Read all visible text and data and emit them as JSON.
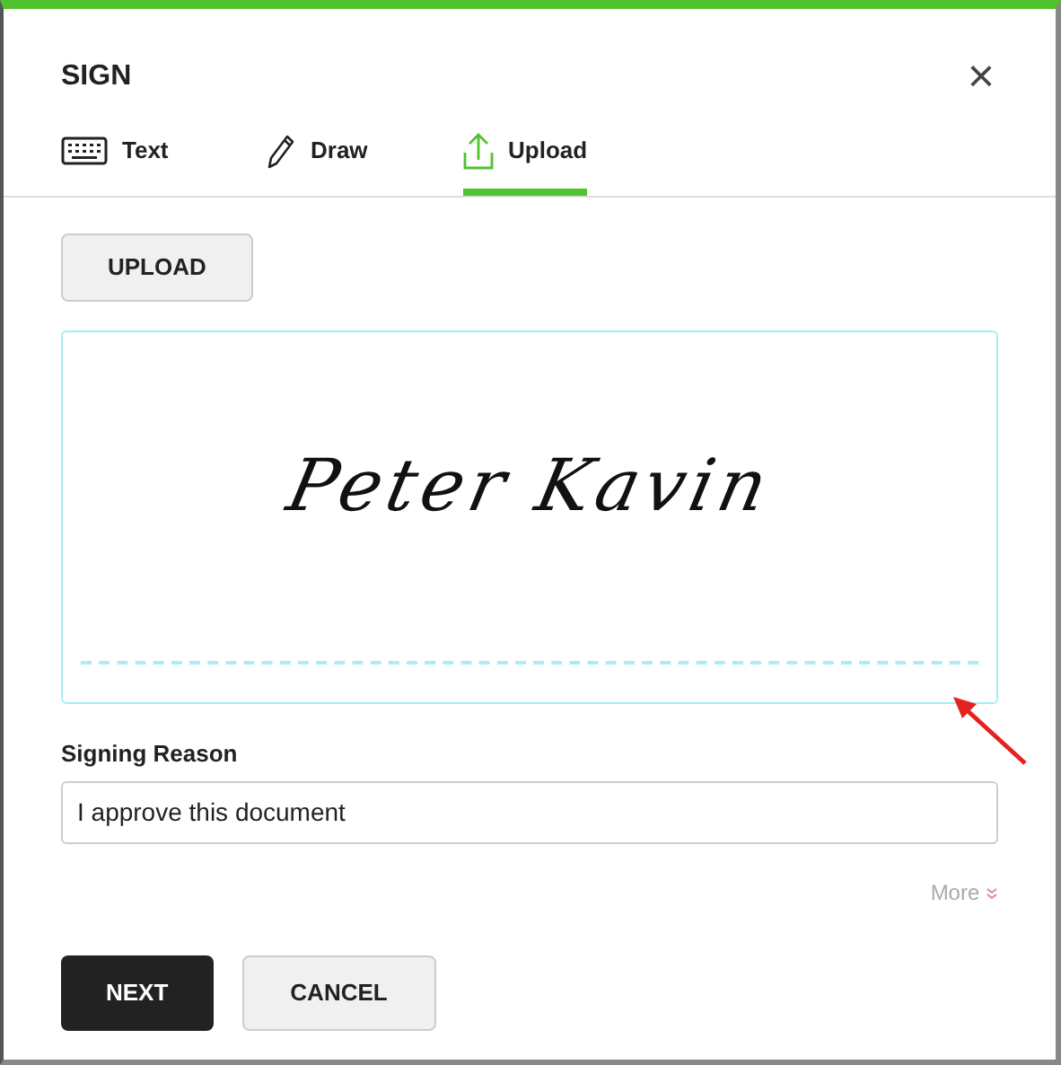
{
  "dialog": {
    "title": "SIGN",
    "close": "×"
  },
  "tabs": [
    {
      "kind": "keyboard",
      "label": "Text",
      "selected": false
    },
    {
      "kind": "pen",
      "label": "Draw",
      "selected": false
    },
    {
      "kind": "upload",
      "label": "Upload",
      "selected": true
    }
  ],
  "upload_button": "UPLOAD",
  "signature": "Peter Kavin",
  "reason": {
    "label": "Signing Reason",
    "value": "I approve this document"
  },
  "more": "More",
  "buttons": [
    {
      "kind": "primary",
      "label": "NEXT"
    },
    {
      "kind": "secondary",
      "label": "CANCEL"
    }
  ]
}
